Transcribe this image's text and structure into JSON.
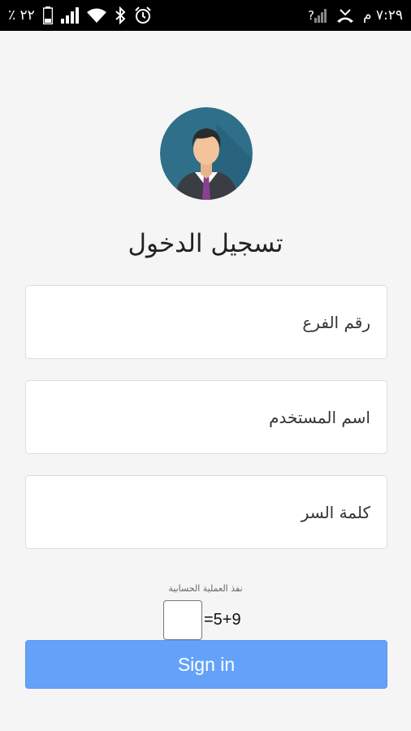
{
  "status_bar": {
    "battery_percent": "٢٢ ٪",
    "signal_text": "?",
    "time": "٧:٢٩ م",
    "left_icons": [
      "battery-icon",
      "signal-icon",
      "wifi-icon",
      "bluetooth-icon",
      "alarm-icon"
    ],
    "right_icons": [
      "no-signal-icon",
      "missed-call-icon"
    ]
  },
  "login": {
    "title": "تسجيل الدخول",
    "branch_placeholder": "رقم الفرع",
    "username_placeholder": "اسم المستخدم",
    "password_placeholder": "كلمة السر",
    "captcha_label": "نفذ العملية الحسابية",
    "captcha_equation": "=5+9",
    "signin_label": "Sign in"
  },
  "colors": {
    "status_bar_bg": "#000000",
    "page_bg": "#f5f5f5",
    "button_bg": "#64a2f9",
    "avatar_bg": "#2f6f89"
  }
}
